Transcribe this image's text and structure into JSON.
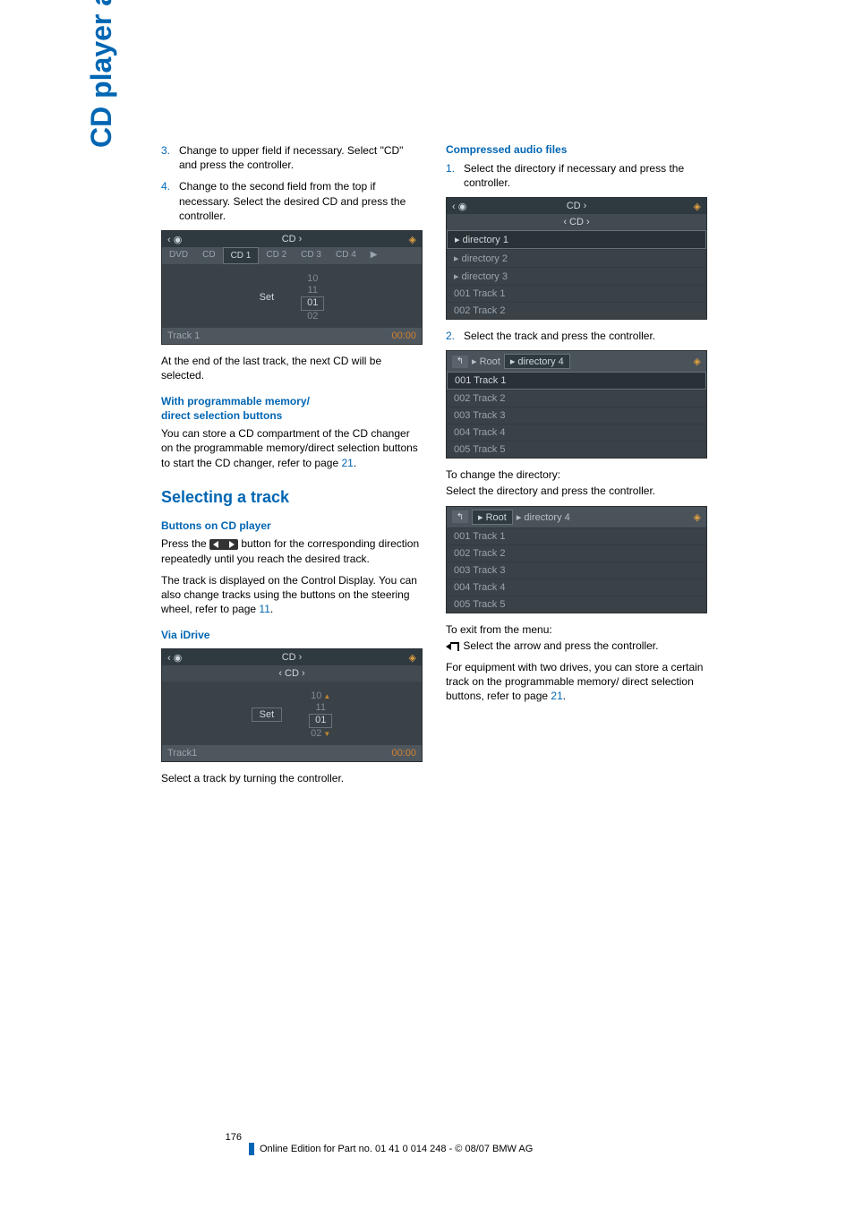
{
  "side_title": "CD player and CD changer",
  "left": {
    "steps_a": [
      {
        "num": "3.",
        "text": "Change to upper field if necessary. Select \"CD\" and press the controller."
      },
      {
        "num": "4.",
        "text": "Change to the second field from the top if necessary. Select the desired CD and press the controller."
      }
    ],
    "shot1": {
      "bar": "CD",
      "tabs": [
        "DVD",
        "CD",
        "CD 1",
        "CD 2",
        "CD 3",
        "CD 4"
      ],
      "tabs_sel": 2,
      "set": "Set",
      "nums": [
        "10",
        "11",
        "01",
        "02"
      ],
      "nums_sel": 2,
      "foot_left": "Track 1",
      "foot_right": "00:00"
    },
    "after_shot1": "At the end of the last track, the next CD will be selected.",
    "h_prog": "With programmable memory/\ndirect selection buttons",
    "prog_text_a": "You can store a CD compartment of the CD changer on the programmable memory/direct selection buttons to start the CD changer, refer to page ",
    "prog_link": "21",
    "h_select": "Selecting a track",
    "h_buttons": "Buttons on CD player",
    "buttons_text_a": "Press the ",
    "buttons_text_b": " button for the corresponding direction repeatedly until you reach the desired track.",
    "buttons_text_c": "The track is displayed on the Control Display. You can also change tracks using the buttons on the steering wheel, refer to page ",
    "buttons_link": "11",
    "h_idrive": "Via iDrive",
    "shot2": {
      "bar": "CD",
      "sub": "CD",
      "set": "Set",
      "nums": [
        "10",
        "11",
        "01",
        "02"
      ],
      "foot_left": "Track1",
      "foot_right": "00:00"
    },
    "idrive_caption": "Select a track by turning the controller."
  },
  "right": {
    "h_comp": "Compressed audio files",
    "steps_b": [
      {
        "num": "1.",
        "text": "Select the directory if necessary and press the controller."
      }
    ],
    "shot3": {
      "bar": "CD",
      "sub": "CD",
      "rows": [
        "directory 1",
        "directory 2",
        "directory 3",
        "001 Track 1",
        "002 Track 2"
      ],
      "sel": 0
    },
    "steps_c": [
      {
        "num": "2.",
        "text": "Select the track and press the controller."
      }
    ],
    "shot4": {
      "crumb": [
        "Root",
        "directory 4"
      ],
      "crumb_sel": 1,
      "rows": [
        "001 Track 1",
        "002 Track 2",
        "003 Track 3",
        "004 Track 4",
        "005 Track 5"
      ],
      "sel": 0
    },
    "change_dir_a": "To change the directory:",
    "change_dir_b": "Select the directory and press the controller.",
    "shot5": {
      "crumb": [
        "Root",
        "directory 4"
      ],
      "crumb_sel": 0,
      "rows": [
        "001 Track 1",
        "002 Track 2",
        "003 Track 3",
        "004 Track 4",
        "005 Track 5"
      ]
    },
    "exit_a": "To exit from the menu:",
    "exit_b": "Select the arrow and press the controller.",
    "equip_a": "For equipment with two drives, you can store a certain track on the programmable memory/ direct selection buttons, refer to page ",
    "equip_link": "21"
  },
  "footer": {
    "page_num": "176",
    "copyright": "Online Edition for Part no. 01 41 0 014 248 - © 08/07 BMW AG"
  }
}
